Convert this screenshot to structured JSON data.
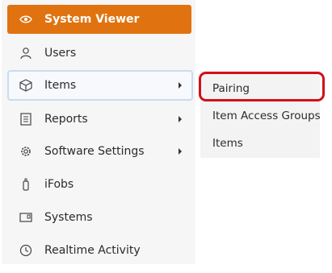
{
  "sidebar": {
    "items": [
      {
        "label": "System Viewer",
        "icon": "eye-icon"
      },
      {
        "label": "Users",
        "icon": "user-icon"
      },
      {
        "label": "Items",
        "icon": "cube-icon"
      },
      {
        "label": "Reports",
        "icon": "report-icon"
      },
      {
        "label": "Software Settings",
        "icon": "gear-icon"
      },
      {
        "label": "iFobs",
        "icon": "fob-icon"
      },
      {
        "label": "Systems",
        "icon": "systems-icon"
      },
      {
        "label": "Realtime Activity",
        "icon": "clock-icon"
      }
    ]
  },
  "submenu": {
    "items": [
      {
        "label": "Pairing"
      },
      {
        "label": "Item Access Groups"
      },
      {
        "label": "Items"
      }
    ]
  },
  "colors": {
    "accent": "#e07310",
    "highlight_border": "#d0101a",
    "selected_border": "#c9dcef"
  }
}
